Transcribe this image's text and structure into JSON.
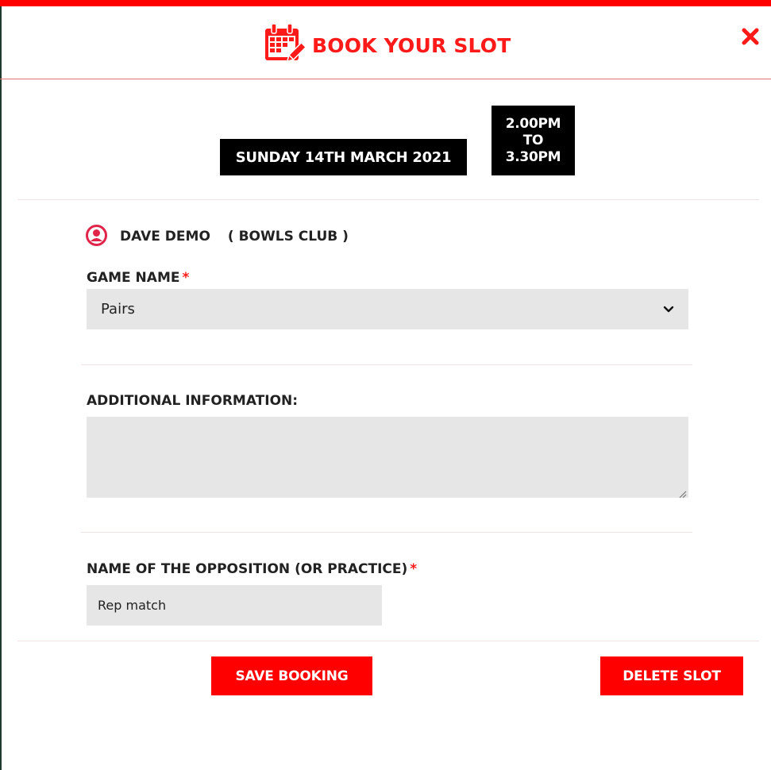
{
  "header": {
    "title": "BOOK YOUR SLOT",
    "icon": "calendar-edit-icon",
    "close_icon": "close-icon",
    "accent_color": "#ff0000"
  },
  "slot": {
    "date": "SUNDAY 14TH MARCH 2021",
    "time_start": "2.00PM",
    "time_separator": "TO",
    "time_end": "3.30PM"
  },
  "user": {
    "icon": "user-icon",
    "name": "DAVE DEMO",
    "club": "( BOWLS CLUB )"
  },
  "form": {
    "game_name": {
      "label": "GAME NAME",
      "required_mark": "*",
      "selected_value": "Pairs"
    },
    "additional_info": {
      "label": "ADDITIONAL INFORMATION:",
      "value": ""
    },
    "opposition": {
      "label": "NAME OF THE OPPOSITION (OR PRACTICE)",
      "required_mark": "*",
      "value": "Rep match"
    }
  },
  "actions": {
    "save_label": "SAVE BOOKING",
    "delete_label": "DELETE SLOT"
  }
}
